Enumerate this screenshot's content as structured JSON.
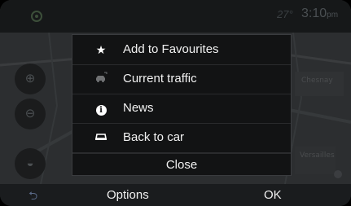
{
  "status": {
    "temperature": "27°",
    "time": "3:10",
    "time_suffix": "pm"
  },
  "map": {
    "labels": [
      "Chesnay",
      "Versailles"
    ]
  },
  "menu": {
    "items": [
      {
        "icon": "star-icon",
        "label": "Add to Favourites"
      },
      {
        "icon": "traffic-car-icon",
        "label": "Current traffic"
      },
      {
        "icon": "info-icon",
        "label": "News"
      },
      {
        "icon": "car-icon",
        "label": "Back to car"
      }
    ],
    "close_label": "Close"
  },
  "bottom_bar": {
    "back_icon": "back-arrow-icon",
    "options_label": "Options",
    "ok_label": "OK"
  },
  "colors": {
    "popup_bg": "#121314",
    "bar_bg": "#1a1c1e",
    "text": "#f2f2f2"
  }
}
